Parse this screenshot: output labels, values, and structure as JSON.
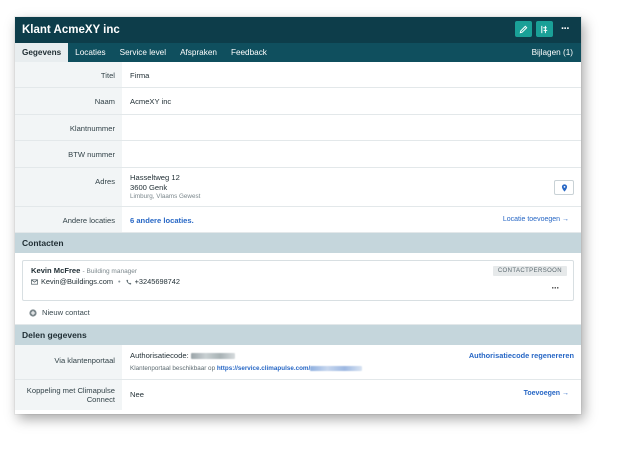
{
  "header": {
    "title": "Klant AcmeXY inc",
    "edit_icon": "pencil-icon",
    "filter_icon": "sliders-icon",
    "more_label": "···"
  },
  "tabs": [
    {
      "label": "Gegevens",
      "active": true
    },
    {
      "label": "Locaties",
      "active": false
    },
    {
      "label": "Service level",
      "active": false
    },
    {
      "label": "Afspraken",
      "active": false
    },
    {
      "label": "Feedback",
      "active": false
    }
  ],
  "attachments_label": "Bijlagen (1)",
  "fields": {
    "titel": {
      "label": "Titel",
      "value": "Firma"
    },
    "naam": {
      "label": "Naam",
      "value": "AcmeXY inc"
    },
    "klantnummer": {
      "label": "Klantnummer",
      "value": ""
    },
    "btw": {
      "label": "BTW nummer",
      "value": ""
    },
    "adres": {
      "label": "Adres",
      "street": "Hasseltweg 12",
      "city": "3600 Genk",
      "region": "Limburg, Vlaams Gewest",
      "map_icon": "map-pin-icon"
    },
    "andere_locaties": {
      "label": "Andere locaties",
      "value": "6 andere locaties.",
      "action": "Locatie toevoegen →"
    }
  },
  "contacten": {
    "title": "Contacten",
    "contact": {
      "name": "Kevin McFree",
      "role": "- Building manager",
      "email": "Kevin@Buildings.com",
      "separator": "•",
      "phone": "+3245698742",
      "badge": "CONTACTPERSOON",
      "more": "···"
    },
    "new_contact": "Nieuw contact"
  },
  "delen": {
    "title": "Delen gegevens",
    "portaal": {
      "label": "Via klantenportaal",
      "code_label": "Authorisatiecode:",
      "regenerate": "Authorisatiecode regenereren",
      "available_text": "Klantenportaal beschikbaar op",
      "url_prefix": "https://service.climapulse.com/"
    },
    "koppeling": {
      "label_line1": "Koppeling met Climapulse",
      "label_line2": "Connect",
      "value": "Nee",
      "action": "Toevoegen →"
    }
  },
  "colors": {
    "header_bg": "#0d3d4a",
    "tabbar_bg": "#0f4f5e",
    "accent": "#1aa097",
    "link": "#2767c5",
    "section_bg": "#c5d6dc"
  }
}
